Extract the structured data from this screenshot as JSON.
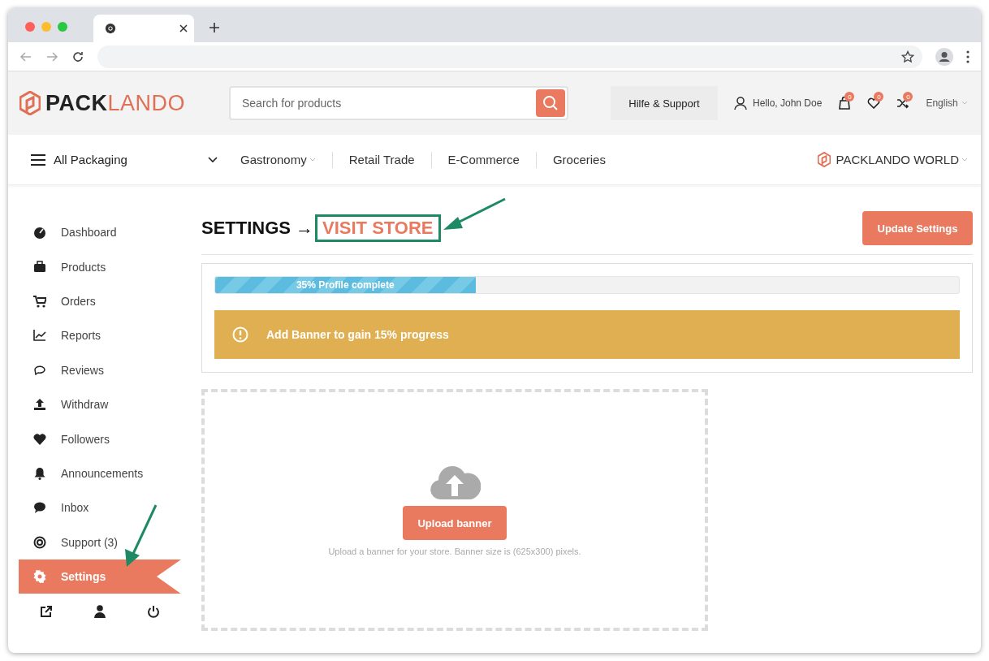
{
  "header": {
    "logo": {
      "first": "PACK",
      "second": "LANDO"
    },
    "search": {
      "placeholder": "Search for products"
    },
    "help": "Hilfe & Support",
    "user": "Hello, John Doe",
    "counters": [
      {
        "count": "0"
      },
      {
        "count": "0"
      },
      {
        "count": "0"
      }
    ],
    "language": "English"
  },
  "nav": {
    "all": "All Packaging",
    "links": [
      {
        "label": "Gastronomy",
        "dropdown": true
      },
      {
        "label": "Retail Trade",
        "dropdown": false
      },
      {
        "label": "E-Commerce",
        "dropdown": false
      },
      {
        "label": "Groceries",
        "dropdown": false
      }
    ],
    "world": "PACKLANDO WORLD"
  },
  "sidebar": {
    "items": [
      {
        "label": "Dashboard",
        "selected": false
      },
      {
        "label": "Products",
        "selected": false
      },
      {
        "label": "Orders",
        "selected": false
      },
      {
        "label": "Reports",
        "selected": false
      },
      {
        "label": "Reviews",
        "selected": false
      },
      {
        "label": "Withdraw",
        "selected": false
      },
      {
        "label": "Followers",
        "selected": false
      },
      {
        "label": "Announcements",
        "selected": false
      },
      {
        "label": "Inbox",
        "selected": false
      },
      {
        "label": "Support (3)",
        "selected": false
      },
      {
        "label": "Settings",
        "selected": true
      }
    ]
  },
  "page": {
    "title": "SETTINGS",
    "arrow": "→",
    "visit_store": "VISIT STORE",
    "update_button": "Update Settings",
    "progress": {
      "level": 0.35,
      "label": "35% Profile complete"
    },
    "alert": "Add Banner to gain 15% progress",
    "upload": {
      "button": "Upload banner",
      "hint": "Upload a banner for your store. Banner size is (625x300) pixels."
    }
  }
}
